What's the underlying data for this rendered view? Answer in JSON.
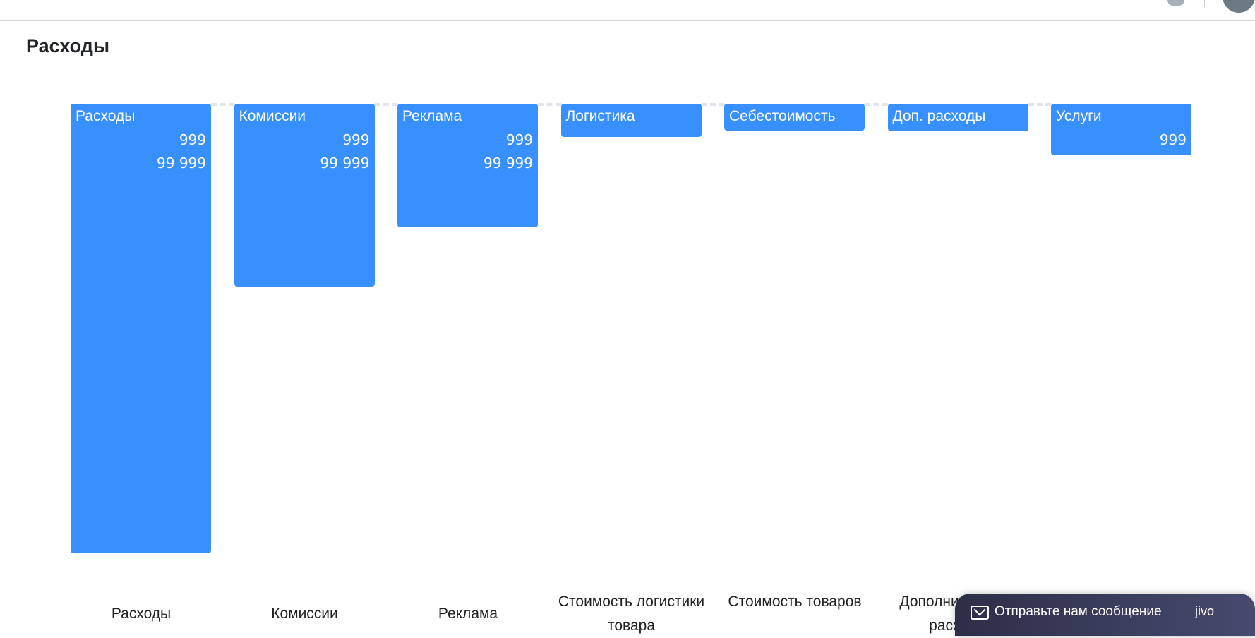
{
  "page": {
    "title": "Расходы"
  },
  "chat_widget": {
    "label": "Отправьте нам сообщение",
    "brand": "jivo",
    "icon": "mail-icon"
  },
  "chart_data": {
    "type": "bar",
    "title": "",
    "bar_color": "#3890fe",
    "note": "relative bar lengths as percent of the first bar",
    "bars": [
      {
        "name": "Расходы",
        "count": "999",
        "sum": "99 999",
        "category": "Расходы",
        "value": 100
      },
      {
        "name": "Комиссии",
        "count": "999",
        "sum": "99 999",
        "category": "Комиссии",
        "value": 40.7
      },
      {
        "name": "Реклама",
        "count": "999",
        "sum": "99 999",
        "category": "Реклама",
        "value": 27.5
      },
      {
        "name": "Логистика",
        "count": null,
        "sum": null,
        "category": "Стоимость логистики товара",
        "value": 7.4
      },
      {
        "name": "Себестоимость",
        "count": null,
        "sum": null,
        "category": "Стоимость товаров",
        "value": 6.0
      },
      {
        "name": "Доп. расходы",
        "count": null,
        "sum": null,
        "category": "Дополнительные расходы",
        "value": 6.1
      },
      {
        "name": "Услуги",
        "count": "999",
        "sum": null,
        "category": "",
        "value": 11.5
      }
    ]
  }
}
